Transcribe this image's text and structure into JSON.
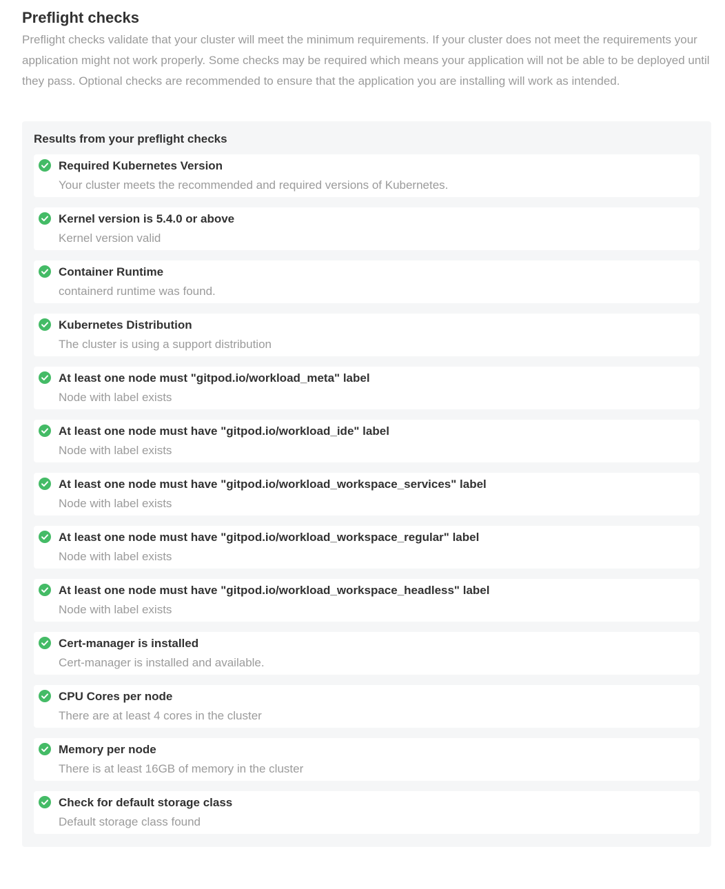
{
  "header": {
    "title": "Preflight checks",
    "description": "Preflight checks validate that your cluster will meet the minimum requirements. If your cluster does not meet the requirements your application might not work properly. Some checks may be required which means your application will not be able to be deployed until they pass. Optional checks are recommended to ensure that the application you are installing will work as intended."
  },
  "results": {
    "title": "Results from your preflight checks",
    "status_icon": "check-circle-icon",
    "status_color": "#44bb66",
    "checks": [
      {
        "title": "Required Kubernetes Version",
        "message": "Your cluster meets the recommended and required versions of Kubernetes."
      },
      {
        "title": "Kernel version is 5.4.0 or above",
        "message": "Kernel version valid"
      },
      {
        "title": "Container Runtime",
        "message": "containerd runtime was found."
      },
      {
        "title": "Kubernetes Distribution",
        "message": "The cluster is using a support distribution"
      },
      {
        "title": "At least one node must \"gitpod.io/workload_meta\" label",
        "message": "Node with label exists"
      },
      {
        "title": "At least one node must have \"gitpod.io/workload_ide\" label",
        "message": "Node with label exists"
      },
      {
        "title": "At least one node must have \"gitpod.io/workload_workspace_services\" label",
        "message": "Node with label exists"
      },
      {
        "title": "At least one node must have \"gitpod.io/workload_workspace_regular\" label",
        "message": "Node with label exists"
      },
      {
        "title": "At least one node must have \"gitpod.io/workload_workspace_headless\" label",
        "message": "Node with label exists"
      },
      {
        "title": "Cert-manager is installed",
        "message": "Cert-manager is installed and available."
      },
      {
        "title": "CPU Cores per node",
        "message": "There are at least 4 cores in the cluster"
      },
      {
        "title": "Memory per node",
        "message": "There is at least 16GB of memory in the cluster"
      },
      {
        "title": "Check for default storage class",
        "message": "Default storage class found"
      }
    ]
  }
}
